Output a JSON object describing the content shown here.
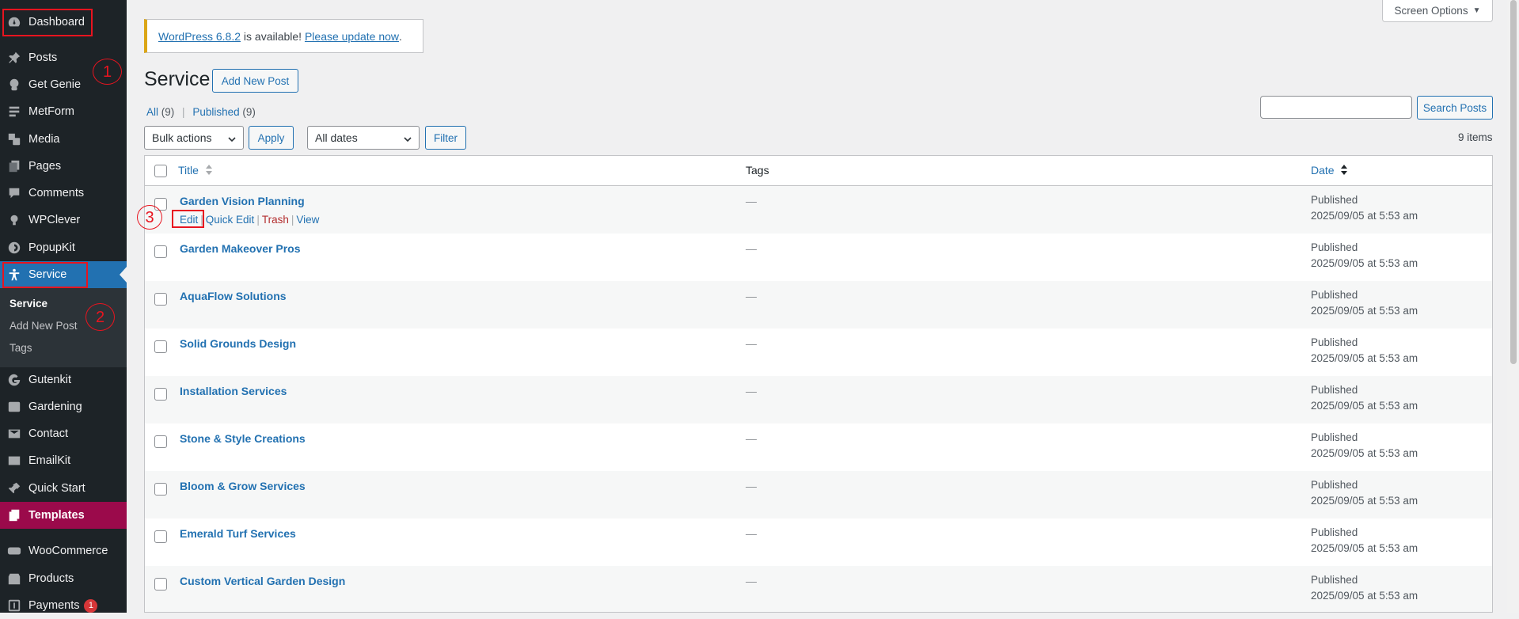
{
  "menu": {
    "items": [
      {
        "label": "Dashboard",
        "icon": "dashboard-icon"
      },
      {
        "label": "Posts",
        "icon": "pin-icon"
      },
      {
        "label": "Get Genie",
        "icon": "genie-icon"
      },
      {
        "label": "MetForm",
        "icon": "form-icon"
      },
      {
        "label": "Media",
        "icon": "media-icon"
      },
      {
        "label": "Pages",
        "icon": "pages-icon"
      },
      {
        "label": "Comments",
        "icon": "comments-icon"
      },
      {
        "label": "WPClever",
        "icon": "bulb-icon"
      },
      {
        "label": "PopupKit",
        "icon": "popup-icon"
      },
      {
        "label": "Service",
        "icon": "person-icon"
      },
      {
        "label": "Gutenkit",
        "icon": "gutenkit-icon"
      },
      {
        "label": "Gardening",
        "icon": "gardening-icon"
      },
      {
        "label": "Contact",
        "icon": "mail-icon"
      },
      {
        "label": "EmailKit",
        "icon": "mail-icon"
      },
      {
        "label": "Quick Start",
        "icon": "plug-icon"
      },
      {
        "label": "Templates",
        "icon": "templates-icon"
      },
      {
        "label": "WooCommerce",
        "icon": "woo-icon"
      },
      {
        "label": "Products",
        "icon": "products-icon"
      },
      {
        "label": "Payments",
        "icon": "payments-icon",
        "badge": "1"
      }
    ],
    "submenu": [
      {
        "label": "Service"
      },
      {
        "label": "Add New Post"
      },
      {
        "label": "Tags"
      }
    ]
  },
  "annotations": {
    "one": "1",
    "two": "2",
    "three": "3"
  },
  "screen_options": "Screen Options",
  "notice": {
    "version_link": "WordPress 6.8.2",
    "middle": " is available! ",
    "update_link": "Please update now",
    "end": "."
  },
  "page": {
    "title": "Service",
    "add_new": "Add New Post"
  },
  "views": {
    "all": "All",
    "all_count": "(9)",
    "separator": "|",
    "published": "Published",
    "published_count": "(9)"
  },
  "search": {
    "button": "Search Posts",
    "value": ""
  },
  "bulk": {
    "selected": "Bulk actions",
    "apply": "Apply"
  },
  "dates": {
    "selected": "All dates",
    "filter": "Filter"
  },
  "items_count": "9 items",
  "table": {
    "headers": {
      "title": "Title",
      "tags": "Tags",
      "date": "Date"
    },
    "row_actions": {
      "edit": "Edit",
      "quick_edit": "Quick Edit",
      "trash": "Trash",
      "view": "View",
      "sep": "|"
    },
    "rows": [
      {
        "title": "Garden Vision Planning",
        "tags": "—",
        "status": "Published",
        "date": "2025/09/05 at 5:53 am"
      },
      {
        "title": "Garden Makeover Pros",
        "tags": "—",
        "status": "Published",
        "date": "2025/09/05 at 5:53 am"
      },
      {
        "title": "AquaFlow Solutions",
        "tags": "—",
        "status": "Published",
        "date": "2025/09/05 at 5:53 am"
      },
      {
        "title": "Solid Grounds Design",
        "tags": "—",
        "status": "Published",
        "date": "2025/09/05 at 5:53 am"
      },
      {
        "title": "Installation Services",
        "tags": "—",
        "status": "Published",
        "date": "2025/09/05 at 5:53 am"
      },
      {
        "title": "Stone & Style Creations",
        "tags": "—",
        "status": "Published",
        "date": "2025/09/05 at 5:53 am"
      },
      {
        "title": "Bloom & Grow Services",
        "tags": "—",
        "status": "Published",
        "date": "2025/09/05 at 5:53 am"
      },
      {
        "title": "Emerald Turf Services",
        "tags": "—",
        "status": "Published",
        "date": "2025/09/05 at 5:53 am"
      },
      {
        "title": "Custom Vertical Garden Design",
        "tags": "—",
        "status": "Published",
        "date": "2025/09/05 at 5:53 am"
      }
    ]
  },
  "colors": {
    "menu_bg": "#1d2327",
    "current_bg": "#2271b1",
    "templates_bg": "#9b0a4b",
    "link": "#2271b1",
    "trash": "#b32d2e",
    "annotation": "#e8141f"
  }
}
